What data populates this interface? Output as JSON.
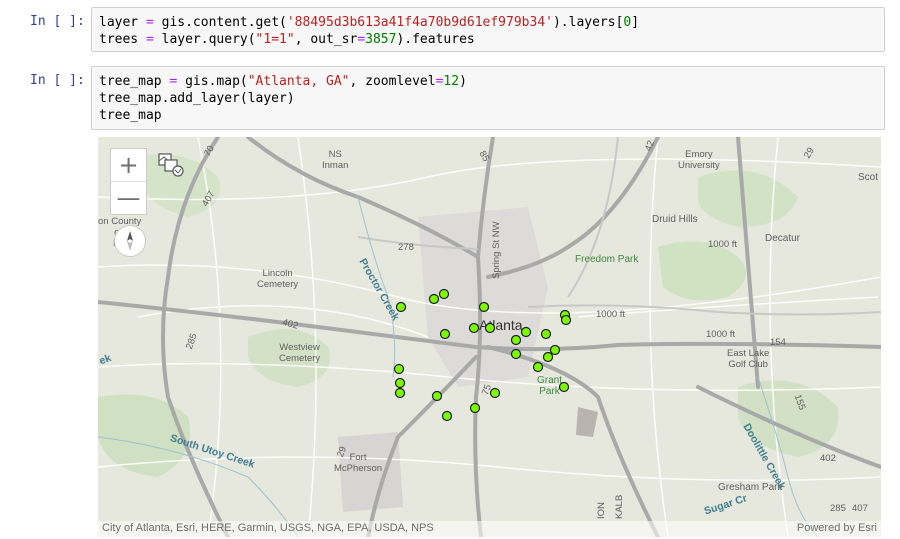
{
  "cells": [
    {
      "prompt": "In [ ]:",
      "lines": [
        [
          {
            "t": "layer "
          },
          {
            "t": "=",
            "c": "op"
          },
          {
            "t": " gis.content.get("
          },
          {
            "t": "'88495d3b613a41f4a70b9d61ef979b34'",
            "c": "str"
          },
          {
            "t": ").layers["
          },
          {
            "t": "0",
            "c": "num"
          },
          {
            "t": "]"
          }
        ],
        [
          {
            "t": "trees "
          },
          {
            "t": "=",
            "c": "op"
          },
          {
            "t": " layer.query("
          },
          {
            "t": "\"1=1\"",
            "c": "str"
          },
          {
            "t": ", out_sr"
          },
          {
            "t": "=",
            "c": "op"
          },
          {
            "t": "3857",
            "c": "num"
          },
          {
            "t": ").features"
          }
        ]
      ]
    },
    {
      "prompt": "In [ ]:",
      "lines": [
        [
          {
            "t": "tree_map "
          },
          {
            "t": "=",
            "c": "op"
          },
          {
            "t": " gis.map("
          },
          {
            "t": "\"Atlanta, GA\"",
            "c": "str"
          },
          {
            "t": ", zoomlevel"
          },
          {
            "t": "=",
            "c": "op"
          },
          {
            "t": "12",
            "c": "num"
          },
          {
            "t": ")"
          }
        ],
        [
          {
            "t": "tree_map.add_layer(layer)"
          }
        ],
        [
          {
            "t": "tree_map"
          }
        ]
      ]
    }
  ],
  "map": {
    "zoom_in": "+",
    "zoom_out": "—",
    "attribution": "City of Atlanta, Esri, HERE, Garmin, USGS, NGA, EPA, USDA, NPS",
    "powered_by": "Powered by Esri",
    "point_color": "#7cfc00",
    "labels": [
      {
        "text": "NS\nInman",
        "cls": "lbl sm"
      },
      {
        "text": "Emory\nUniversity",
        "cls": "lbl sm"
      },
      {
        "text": "Scot",
        "cls": "lbl"
      },
      {
        "text": "Druid Hills",
        "cls": "lbl"
      },
      {
        "text": "Decatur",
        "cls": "lbl"
      },
      {
        "text": "on County\nort\nFie",
        "cls": "lbl sm"
      },
      {
        "text": "Freedom Park",
        "cls": "lbl green"
      },
      {
        "text": "Lincoln\nCemetery",
        "cls": "lbl sm"
      },
      {
        "text": "Westview\nCemetery",
        "cls": "lbl sm"
      },
      {
        "text": "Atlanta",
        "cls": "lbl big"
      },
      {
        "text": "East Lake\nGolf Club",
        "cls": "lbl sm"
      },
      {
        "text": "Grant\nPark",
        "cls": "lbl green"
      },
      {
        "text": "Fort\nMcPherson",
        "cls": "lbl sm"
      },
      {
        "text": "Gresham Park",
        "cls": "lbl"
      },
      {
        "text": "Druid Hills",
        "cls": "lbl"
      },
      {
        "text": "Spring St NW",
        "cls": "lbl sm"
      },
      {
        "text": "Proctor Creek",
        "cls": "lbl blue"
      },
      {
        "text": "South Utoy Creek",
        "cls": "lbl blue"
      },
      {
        "text": "Doolittle Creek",
        "cls": "lbl blue"
      },
      {
        "text": "Sugar Cr",
        "cls": "lbl blue"
      },
      {
        "text": "ek",
        "cls": "lbl blue"
      },
      {
        "text": "1000 ft",
        "cls": "lbl sm"
      },
      {
        "text": "1000 ft",
        "cls": "lbl sm"
      },
      {
        "text": "1000 ft",
        "cls": "lbl sm"
      },
      {
        "text": "278",
        "cls": "lbl sm"
      },
      {
        "text": "402",
        "cls": "lbl sm"
      },
      {
        "text": "402",
        "cls": "lbl sm"
      },
      {
        "text": "285",
        "cls": "lbl sm"
      },
      {
        "text": "285",
        "cls": "lbl sm"
      },
      {
        "text": "407",
        "cls": "lbl sm"
      },
      {
        "text": "407",
        "cls": "lbl sm"
      },
      {
        "text": "154",
        "cls": "lbl sm"
      },
      {
        "text": "155",
        "cls": "lbl sm"
      },
      {
        "text": "29",
        "cls": "lbl sm"
      },
      {
        "text": "29",
        "cls": "lbl sm"
      },
      {
        "text": "75",
        "cls": "lbl sm"
      },
      {
        "text": "85",
        "cls": "lbl sm"
      },
      {
        "text": "ION",
        "cls": "lbl sm"
      },
      {
        "text": "KALB",
        "cls": "lbl sm"
      },
      {
        "text": "42",
        "cls": "lbl sm"
      },
      {
        "text": "70",
        "cls": "lbl sm"
      }
    ]
  }
}
